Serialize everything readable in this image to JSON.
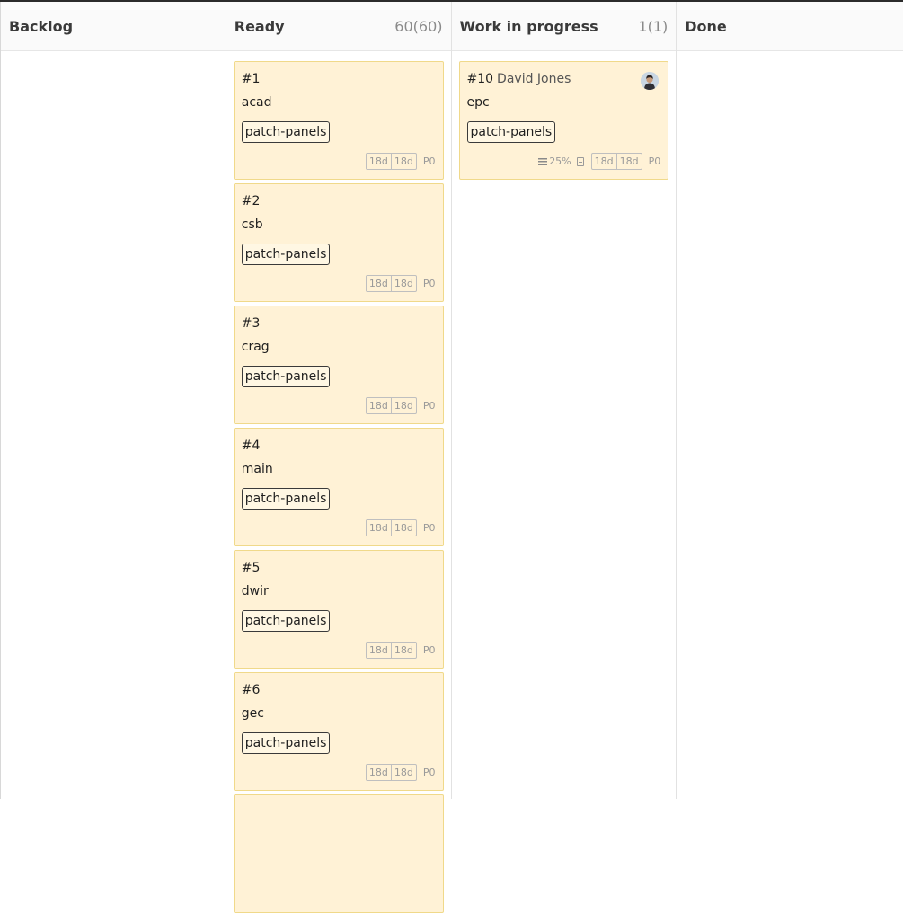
{
  "columns": [
    {
      "title": "Backlog",
      "count": ""
    },
    {
      "title": "Ready",
      "count": "60(60)"
    },
    {
      "title": "Work in progress",
      "count": "1(1)"
    },
    {
      "title": "Done",
      "count": ""
    }
  ],
  "ready_cards": [
    {
      "number": "#1",
      "title": "acad",
      "tag": "patch-panels",
      "age_a": "18d",
      "age_b": "18d",
      "priority": "P0"
    },
    {
      "number": "#2",
      "title": "csb",
      "tag": "patch-panels",
      "age_a": "18d",
      "age_b": "18d",
      "priority": "P0"
    },
    {
      "number": "#3",
      "title": "crag",
      "tag": "patch-panels",
      "age_a": "18d",
      "age_b": "18d",
      "priority": "P0"
    },
    {
      "number": "#4",
      "title": "main",
      "tag": "patch-panels",
      "age_a": "18d",
      "age_b": "18d",
      "priority": "P0"
    },
    {
      "number": "#5",
      "title": "dwir",
      "tag": "patch-panels",
      "age_a": "18d",
      "age_b": "18d",
      "priority": "P0"
    },
    {
      "number": "#6",
      "title": "gec",
      "tag": "patch-panels",
      "age_a": "18d",
      "age_b": "18d",
      "priority": "P0"
    }
  ],
  "wip_cards": [
    {
      "number": "#10",
      "assignee": "David Jones",
      "title": "epc",
      "tag": "patch-panels",
      "progress": "25%",
      "age_a": "18d",
      "age_b": "18d",
      "priority": "P0",
      "avatar_icon": "user-avatar"
    }
  ]
}
